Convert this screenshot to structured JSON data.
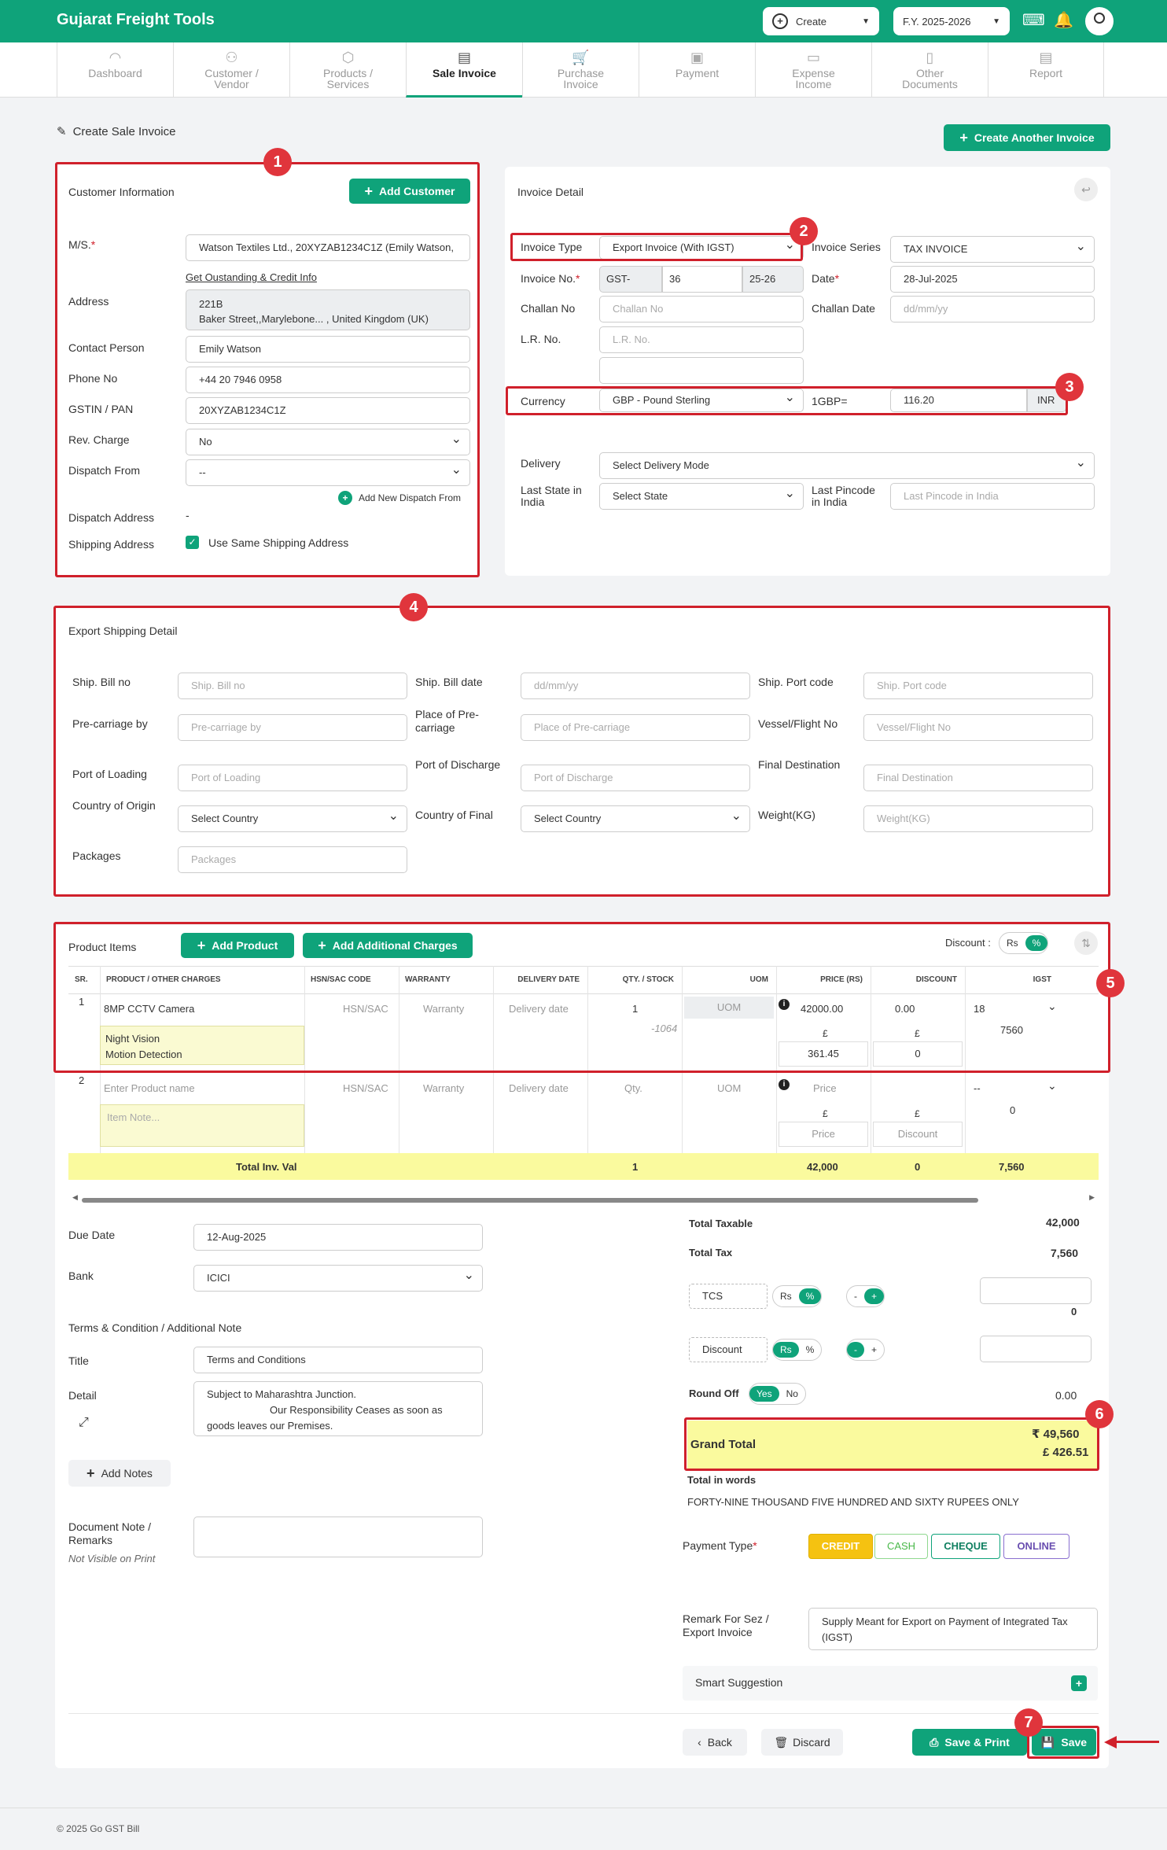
{
  "header": {
    "brand": "Gujarat Freight Tools",
    "create_label": "Create",
    "fy_label": "F.Y. 2025-2026"
  },
  "nav": [
    {
      "label": "Dashboard",
      "icon": "gauge-icon"
    },
    {
      "label": "Customer / Vendor",
      "icon": "users-icon"
    },
    {
      "label": "Products / Services",
      "icon": "box-icon"
    },
    {
      "label": "Sale Invoice",
      "icon": "invoice-icon"
    },
    {
      "label": "Purchase Invoice",
      "icon": "cart-icon"
    },
    {
      "label": "Payment",
      "icon": "payment-icon"
    },
    {
      "label": "Expense Income",
      "icon": "wallet-icon"
    },
    {
      "label": "Other Documents",
      "icon": "document-icon"
    },
    {
      "label": "Report",
      "icon": "report-icon"
    }
  ],
  "page": {
    "title": "Create Sale Invoice",
    "create_another": "Create Another Invoice"
  },
  "customer": {
    "title": "Customer Information",
    "add_btn": "Add Customer",
    "ms_label": "M/S.",
    "ms_value": "Watson Textiles Ltd., 20XYZAB1234C1Z (Emily Watson,",
    "link": "Get Oustanding & Credit Info",
    "address_label": "Address",
    "address_line1": "221B",
    "address_line2": "Baker Street,,Marylebone... , United Kingdom (UK)",
    "contact_label": "Contact Person",
    "contact_value": "Emily Watson",
    "phone_label": "Phone No",
    "phone_value": "+44 20 7946 0958",
    "gstin_label": "GSTIN / PAN",
    "gstin_value": "20XYZAB1234C1Z",
    "rev_label": "Rev. Charge",
    "rev_value": "No",
    "dispatch_from_label": "Dispatch From",
    "dispatch_from_value": "--",
    "add_dispatch": "Add New Dispatch From",
    "dispatch_addr_label": "Dispatch Address",
    "dispatch_addr_value": "-",
    "shipping_label": "Shipping Address",
    "same_shipping": "Use Same Shipping Address"
  },
  "invoice": {
    "title": "Invoice Detail",
    "type_label": "Invoice Type",
    "type_value": "Export Invoice (With IGST)",
    "series_label": "Invoice Series",
    "series_value": "TAX INVOICE",
    "no_label": "Invoice No.",
    "no_prefix": "GST-",
    "no_value": "36",
    "no_suffix": "25-26",
    "date_label": "Date",
    "date_value": "28-Jul-2025",
    "challan_label": "Challan No",
    "challan_ph": "Challan No",
    "challan_date_label": "Challan Date",
    "challan_date_ph": "dd/mm/yy",
    "lr_label": "L.R. No.",
    "lr_ph": "L.R. No.",
    "currency_label": "Currency",
    "currency_value": "GBP - Pound Sterling",
    "rate_label": "1GBP=",
    "rate_value": "116.20",
    "rate_unit": "INR",
    "delivery_label": "Delivery",
    "delivery_value": "Select Delivery Mode",
    "state_label": "Last State in India",
    "state_value": "Select State",
    "pincode_label": "Last Pincode in India",
    "pincode_ph": "Last Pincode in India"
  },
  "export": {
    "title": "Export Shipping Detail",
    "fields": [
      {
        "label": "Ship. Bill no",
        "ph": "Ship. Bill no"
      },
      {
        "label": "Ship. Bill date",
        "ph": "dd/mm/yy"
      },
      {
        "label": "Ship. Port code",
        "ph": "Ship. Port code"
      },
      {
        "label": "Pre-carriage by",
        "ph": "Pre-carriage by"
      },
      {
        "label": "Place of Pre-carriage",
        "ph": "Place of Pre-carriage"
      },
      {
        "label": "Vessel/Flight No",
        "ph": "Vessel/Flight No"
      },
      {
        "label": "Port of Loading",
        "ph": "Port of Loading"
      },
      {
        "label": "Port of Discharge",
        "ph": "Port of Discharge"
      },
      {
        "label": "Final Destination",
        "ph": "Final Destination"
      },
      {
        "label": "Country of Origin",
        "ph": "Select Country"
      },
      {
        "label": "Country of Final",
        "ph": "Select Country"
      },
      {
        "label": "Weight(KG)",
        "ph": "Weight(KG)"
      },
      {
        "label": "Packages",
        "ph": "Packages"
      }
    ]
  },
  "products": {
    "title": "Product Items",
    "add_product": "Add Product",
    "add_charges": "Add Additional Charges",
    "discount_label": "Discount :",
    "rs": "Rs",
    "pct": "%",
    "headers": [
      "SR.",
      "PRODUCT / OTHER CHARGES",
      "HSN/SAC CODE",
      "WARRANTY",
      "DELIVERY DATE",
      "QTY. / STOCK",
      "UOM",
      "PRICE (RS)",
      "DISCOUNT",
      "IGST"
    ],
    "row1": {
      "sr": "1",
      "name": "8MP CCTV Camera",
      "note1": "Night Vision",
      "note2": "Motion Detection",
      "hsn": "HSN/SAC",
      "warranty": "Warranty",
      "delivery": "Delivery date",
      "qty": "1",
      "stock": "-1064",
      "uom": "UOM",
      "price": "42000.00",
      "currency_symbol": "£",
      "price_fx": "361.45",
      "discount": "0.00",
      "discount_fx": "0",
      "igst": "18",
      "igst_amt": "7560"
    },
    "row2": {
      "sr": "2",
      "name_ph": "Enter Product name",
      "note_ph": "Item Note...",
      "hsn": "HSN/SAC",
      "warranty": "Warranty",
      "delivery": "Delivery date",
      "qty": "Qty.",
      "uom": "UOM",
      "price": "Price",
      "currency_symbol": "£",
      "price_fx": "Price",
      "discount_fx": "Discount",
      "igst": "--",
      "igst_amt": "0"
    },
    "total": {
      "label": "Total Inv. Val",
      "qty": "1",
      "price": "42,000",
      "discount": "0",
      "igst": "7,560"
    }
  },
  "bottom": {
    "due_label": "Due Date",
    "due_value": "12-Aug-2025",
    "bank_label": "Bank",
    "bank_value": "ICICI",
    "terms_title": "Terms & Condition / Additional Note",
    "title_label": "Title",
    "title_value": "Terms and Conditions",
    "detail_label": "Detail",
    "detail_line1": "Subject to Maharashtra Junction.",
    "detail_line2": "Our Responsibility Ceases as soon as",
    "detail_line3": "goods leaves our Premises.",
    "add_notes": "Add Notes",
    "doc_note_label": "Document Note / Remarks",
    "doc_note_sub": "Not Visible on Print"
  },
  "totals": {
    "taxable_label": "Total Taxable",
    "taxable_value": "42,000",
    "tax_label": "Total Tax",
    "tax_value": "7,560",
    "tcs_label": "TCS",
    "tcs_value": "0",
    "minus": "-",
    "plus": "+",
    "discount_label": "Discount",
    "roundoff_label": "Round Off",
    "yes": "Yes",
    "no": "No",
    "roundoff_value": "0.00",
    "grand_label": "Grand Total",
    "grand_inr": "₹ 49,560",
    "grand_gbp": "£ 426.51",
    "words_label": "Total in words",
    "words_value": "FORTY-NINE THOUSAND FIVE HUNDRED AND SIXTY RUPEES ONLY",
    "payment_label": "Payment Type",
    "payment_types": [
      "CREDIT",
      "CASH",
      "CHEQUE",
      "ONLINE"
    ],
    "remark_label": "Remark For Sez / Export Invoice",
    "remark_value": "Supply Meant for Export on Payment of Integrated Tax (IGST)",
    "smart": "Smart Suggestion"
  },
  "actions": {
    "back": "Back",
    "discard": "Discard",
    "save_print": "Save & Print",
    "save": "Save"
  },
  "footer": "© 2025 Go GST Bill",
  "badges": [
    "1",
    "2",
    "3",
    "4",
    "5",
    "6",
    "7"
  ]
}
